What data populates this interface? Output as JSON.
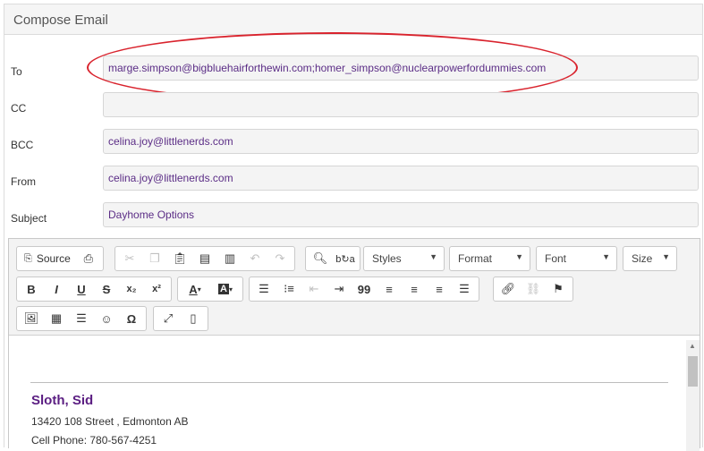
{
  "panel": {
    "title": "Compose Email"
  },
  "form": {
    "to_label": "To",
    "to_value": "marge.simpson@bigbluehairforthewin.com;homer_simpson@nuclearpowerfordummies.com",
    "cc_label": "CC",
    "cc_value": "",
    "bcc_label": "BCC",
    "bcc_value": "celina.joy@littlenerds.com",
    "from_label": "From",
    "from_value": "celina.joy@littlenerds.com",
    "subject_label": "Subject",
    "subject_value": "Dayhome Options"
  },
  "toolbar": {
    "source_label": "Source",
    "styles_label": "Styles",
    "format_label": "Format",
    "font_label": "Font",
    "size_label": "Size",
    "bold": "B",
    "italic": "I",
    "underline": "U",
    "strike": "S",
    "subscript": "x₂",
    "superscript": "x²",
    "quote": "99",
    "special_char": "Ω"
  },
  "editor_content": {
    "name": "Sloth, Sid",
    "address": "13420 108 Street , Edmonton AB",
    "cell": "Cell Phone: 780-567-4251"
  },
  "icons": [
    "source-icon",
    "print-icon",
    "cut-icon",
    "copy-icon",
    "paste-icon",
    "paste-text-icon",
    "paste-word-icon",
    "undo-icon",
    "redo-icon",
    "find-icon",
    "replace-icon",
    "text-color-icon",
    "bg-color-icon",
    "numbered-list-icon",
    "bulleted-list-icon",
    "outdent-icon",
    "indent-icon",
    "align-left-icon",
    "align-center-icon",
    "align-right-icon",
    "justify-icon",
    "link-icon",
    "unlink-icon",
    "anchor-icon",
    "image-icon",
    "table-icon",
    "horizontal-line-icon",
    "smiley-icon",
    "maximize-icon",
    "show-blocks-icon"
  ],
  "colors": {
    "field_text": "#5b2d86",
    "annotation": "#d9232d",
    "signature_name": "#5b1e82"
  }
}
